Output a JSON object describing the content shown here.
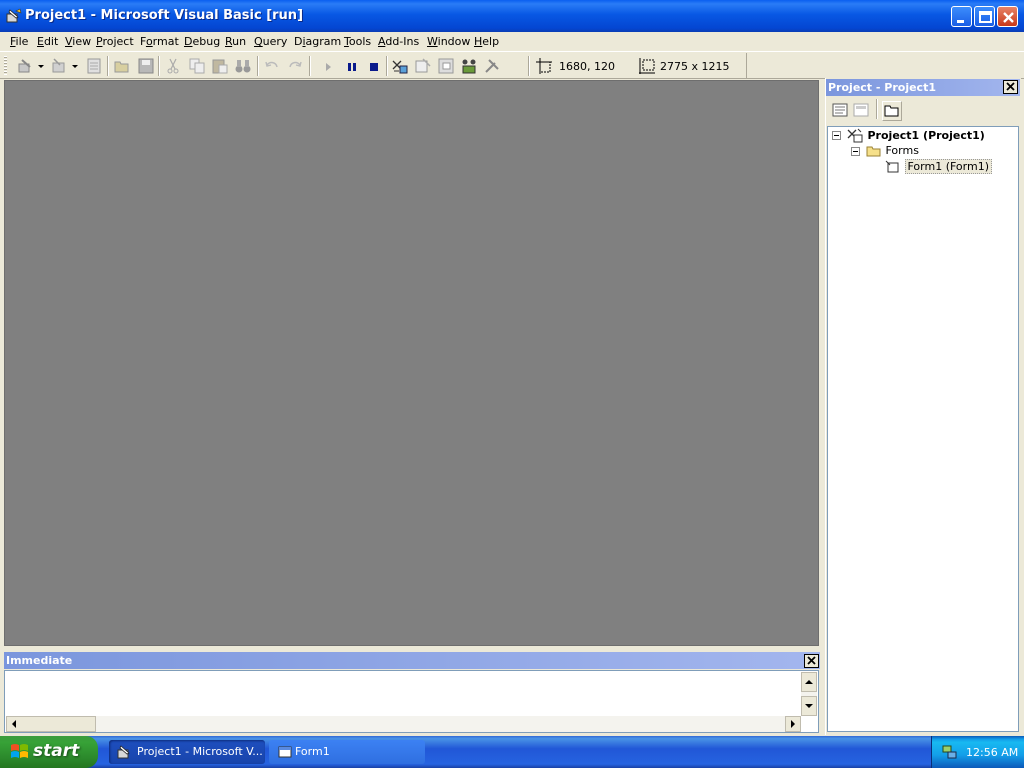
{
  "window": {
    "title": "Project1 - Microsoft Visual Basic [run]"
  },
  "menu": {
    "items": [
      {
        "label": "File",
        "accel": "F",
        "rest": "ile"
      },
      {
        "label": "Edit",
        "accel": "E",
        "rest": "dit"
      },
      {
        "label": "View",
        "accel": "V",
        "rest": "iew"
      },
      {
        "label": "Project",
        "accel": "P",
        "rest": "roject"
      },
      {
        "label": "Format",
        "accel": "o",
        "pre": "F",
        "rest": "rmat"
      },
      {
        "label": "Debug",
        "accel": "D",
        "rest": "ebug"
      },
      {
        "label": "Run",
        "accel": "R",
        "rest": "un"
      },
      {
        "label": "Query",
        "accel": "Q",
        "rest": "uery"
      },
      {
        "label": "Diagram",
        "accel": "i",
        "pre": "D",
        "rest": "agram"
      },
      {
        "label": "Tools",
        "accel": "T",
        "rest": "ools"
      },
      {
        "label": "Add-Ins",
        "accel": "A",
        "rest": "dd-Ins"
      },
      {
        "label": "Window",
        "accel": "W",
        "rest": "indow"
      },
      {
        "label": "Help",
        "accel": "H",
        "rest": "elp"
      }
    ]
  },
  "toolbar": {
    "position_readout": "1680, 120",
    "size_readout": "2775 x 1215"
  },
  "immediate": {
    "title": "Immediate"
  },
  "project": {
    "title": "Project - Project1",
    "root": "Project1 (Project1)",
    "folder": "Forms",
    "form": "Form1 (Form1)"
  },
  "taskbar": {
    "start": "start",
    "tasks": [
      "Project1 - Microsoft V...",
      "Form1"
    ],
    "clock": "12:56 AM"
  },
  "colors": {
    "titlebar": "#0858e4",
    "mdi_background": "#808080",
    "panel_title": "#7b96dd",
    "taskbar": "#2157d7",
    "start_green": "#37a237"
  }
}
